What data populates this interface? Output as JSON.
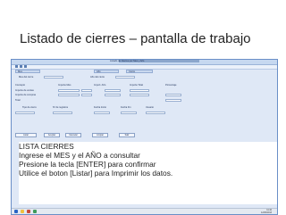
{
  "slide": {
    "title": "Listado de  cierres – pantalla de trabajo"
  },
  "window": {
    "title": "Listado de Cierres por Mes y Año",
    "tabs": [
      "Mes",
      "Año",
      "Cierre"
    ]
  },
  "form": {
    "row1": {
      "label1": "Mes del cierre",
      "label2": "Año del cierre"
    },
    "headers": [
      "Concepto",
      "Importe Mes",
      "Import. Año",
      "Importe Total",
      "Porcentaje"
    ],
    "rows": [
      "Importe de ventas",
      "Importe de compras",
      "Total"
    ],
    "subheaders": [
      "Tipo de cierre",
      "Nº de registros",
      "Fecha Inicio",
      "Fecha Fin",
      "Usuario"
    ]
  },
  "buttons": [
    "Listar",
    "Aceptar",
    "Cancelar",
    "Limpiar",
    "Salir"
  ],
  "instructions": {
    "line1": "LISTA CIERRES",
    "line2": "Ingrese el MES y el AÑO a consultar",
    "line3": "Presione la tecla [ENTER] para confirmar",
    "line4": "Utilice el boton [Listar] para Imprimir los datos."
  },
  "taskbar": {
    "time": "11:42",
    "date": "12/03/2013"
  },
  "colors": {
    "accent": "#6a8fc7",
    "panel": "#dfe8f6",
    "taskbar": "#e4e9f1"
  }
}
